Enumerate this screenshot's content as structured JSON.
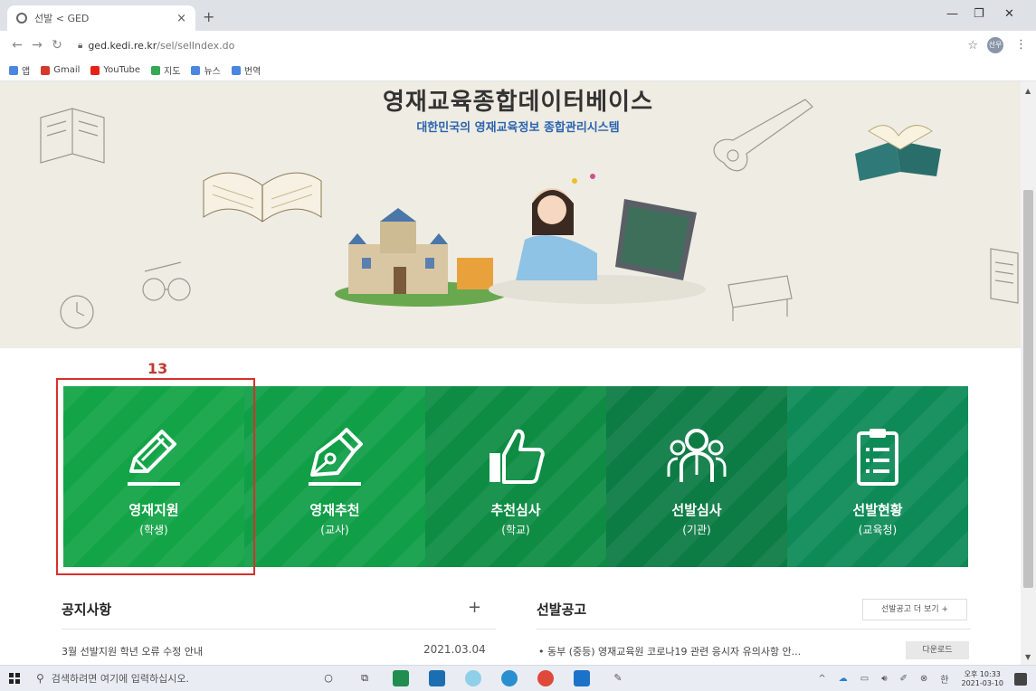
{
  "browser": {
    "tab_title": "선발 < GED",
    "tab_close": "×",
    "new_tab": "+",
    "url_host": "ged.kedi.re.kr",
    "url_path": "/sel/selIndex.do",
    "bookmarks": [
      {
        "label": "앱",
        "color": "#4a87e0"
      },
      {
        "label": "Gmail",
        "color": "#d33a2c"
      },
      {
        "label": "YouTube",
        "color": "#e62117"
      },
      {
        "label": "지도",
        "color": "#34a853"
      },
      {
        "label": "뉴스",
        "color": "#4a87e0"
      },
      {
        "label": "번역",
        "color": "#4a87e0"
      }
    ],
    "profile_initials": "선우"
  },
  "banner": {
    "title": "영재교육종합데이터베이스",
    "subtitle": "대한민국의 영재교육정보 종합관리시스템"
  },
  "annotation": {
    "number": "13"
  },
  "tiles": [
    {
      "label": "영재지원",
      "sub": "(학생)",
      "color": "#13a447",
      "icon": "pencil-icon"
    },
    {
      "label": "영재추천",
      "sub": "(교사)",
      "color": "#109e47",
      "icon": "pen-nib-icon"
    },
    {
      "label": "추천심사",
      "sub": "(학교)",
      "color": "#0e8c44",
      "icon": "thumbs-up-icon"
    },
    {
      "label": "선발심사",
      "sub": "(기관)",
      "color": "#0d7b44",
      "icon": "people-icon"
    },
    {
      "label": "선발현황",
      "sub": "(교육청)",
      "color": "#0e8a57",
      "icon": "clipboard-icon"
    }
  ],
  "notices": {
    "heading": "공지사항",
    "more": "+",
    "items": [
      {
        "title": "3월 선발지원 학년 오류 수정 안내",
        "date": "2021.03.04"
      }
    ]
  },
  "selection": {
    "heading": "선발공고",
    "more_label": "선발공고 더 보기 +",
    "items": [
      {
        "title": "• 동부 (중등) 영재교육원 코로나19 관련 응시자 유의사항 안...",
        "download": "다운로드"
      }
    ]
  },
  "taskbar": {
    "search_placeholder": "검색하려면 여기에 입력하십시오.",
    "ime": "한",
    "time": "오후 10:33",
    "date": "2021-03-10"
  }
}
